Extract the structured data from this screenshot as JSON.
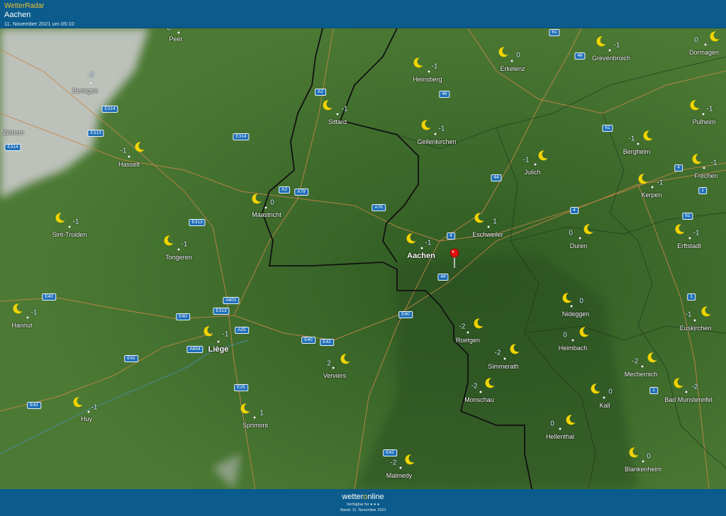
{
  "header": {
    "brand": "WetterRadar",
    "place": "Aachen",
    "timestamp": "11. November 2021 um 05:10"
  },
  "footer": {
    "logo_left": "wetter",
    "logo_mid": "o",
    "logo_right": "nline",
    "available": "Verfügbar für ● ● ●",
    "stand": "Stand: 11. November 2021"
  },
  "icons": {
    "weather": "crescent-moon-icon",
    "pin": "location-pin-icon"
  },
  "colors": {
    "header": "#0b5b8c",
    "terrain": "#3e6b2c",
    "cloud": "#c8c8c8",
    "road_sign": "#1f6fb8",
    "moon": "#f2d300"
  },
  "cities": [
    {
      "name": "Peer",
      "temp": "0"
    },
    {
      "name": "Beringen",
      "temp": "-2"
    },
    {
      "name": "Zichem",
      "temp": ""
    },
    {
      "name": "Hasselt",
      "temp": "-1"
    },
    {
      "name": "Sint-Truiden",
      "temp": "-1"
    },
    {
      "name": "Tongeren",
      "temp": "-1"
    },
    {
      "name": "Hannut",
      "temp": "-1"
    },
    {
      "name": "Huy",
      "temp": "-1"
    },
    {
      "name": "Liège",
      "temp": "-1"
    },
    {
      "name": "Sprimont",
      "temp": "1"
    },
    {
      "name": "Verviers",
      "temp": "2"
    },
    {
      "name": "Malmedy",
      "temp": "-2"
    },
    {
      "name": "Maastricht",
      "temp": "0"
    },
    {
      "name": "Sittard",
      "temp": "-1"
    },
    {
      "name": "Heinsberg",
      "temp": "-1"
    },
    {
      "name": "Geilenkirchen",
      "temp": "-1"
    },
    {
      "name": "Erkelenz",
      "temp": "0"
    },
    {
      "name": "Grevenbroich",
      "temp": "-1"
    },
    {
      "name": "Dormagen",
      "temp": "0"
    },
    {
      "name": "Pulheim",
      "temp": "-1"
    },
    {
      "name": "Bergheim",
      "temp": "-1"
    },
    {
      "name": "Frechen",
      "temp": "-1"
    },
    {
      "name": "Kerpen",
      "temp": "-1"
    },
    {
      "name": "Erftstadt",
      "temp": "-1"
    },
    {
      "name": "Duren",
      "temp": "0"
    },
    {
      "name": "Julich",
      "temp": "-1"
    },
    {
      "name": "Eschweiler",
      "temp": "1"
    },
    {
      "name": "Aachen",
      "temp": "-1"
    },
    {
      "name": "Nideggen",
      "temp": "0"
    },
    {
      "name": "Heimbach",
      "temp": "0"
    },
    {
      "name": "Roetgen",
      "temp": "-2"
    },
    {
      "name": "Simmerath",
      "temp": "-2"
    },
    {
      "name": "Monschau",
      "temp": "-2"
    },
    {
      "name": "Mechernich",
      "temp": "-2"
    },
    {
      "name": "Euskirchen",
      "temp": "-1"
    },
    {
      "name": "Kall",
      "temp": "0"
    },
    {
      "name": "Bad Munstereifel",
      "temp": "-2"
    },
    {
      "name": "Hellenthal",
      "temp": "0"
    },
    {
      "name": "Blankenheim",
      "temp": "0"
    }
  ],
  "roads": [
    "61",
    "46",
    "46",
    "A2",
    "E314",
    "E313",
    "E314",
    "E314",
    "A2",
    "A79",
    "A76",
    "E313",
    "4",
    "44",
    "4",
    "4",
    "61",
    "1",
    "61",
    "E40",
    "A601",
    "E313",
    "E40",
    "A25",
    "A604",
    "E42",
    "E25",
    "E40",
    "E42",
    "E40",
    "44",
    "E42",
    "E42",
    "1",
    "1"
  ]
}
